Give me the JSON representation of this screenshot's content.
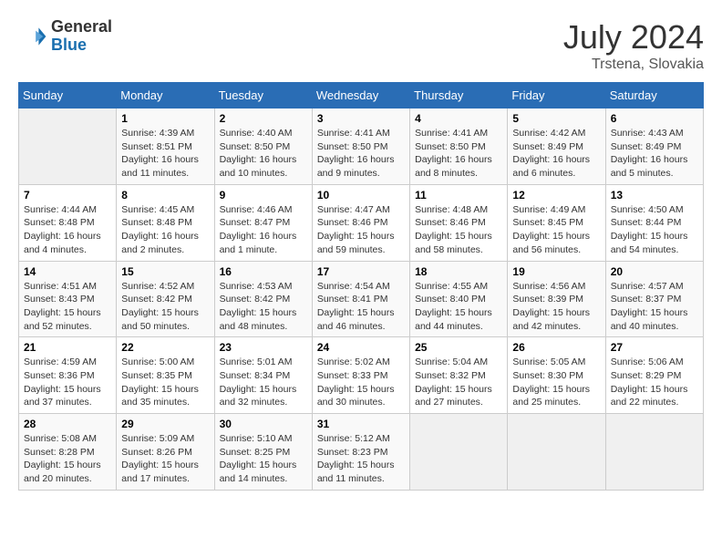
{
  "header": {
    "logo": {
      "general": "General",
      "blue": "Blue"
    },
    "title": "July 2024",
    "location": "Trstena, Slovakia"
  },
  "weekdays": [
    "Sunday",
    "Monday",
    "Tuesday",
    "Wednesday",
    "Thursday",
    "Friday",
    "Saturday"
  ],
  "weeks": [
    [
      {
        "day": null
      },
      {
        "day": "1",
        "sunrise": "4:39 AM",
        "sunset": "8:51 PM",
        "daylight": "16 hours and 11 minutes."
      },
      {
        "day": "2",
        "sunrise": "4:40 AM",
        "sunset": "8:50 PM",
        "daylight": "16 hours and 10 minutes."
      },
      {
        "day": "3",
        "sunrise": "4:41 AM",
        "sunset": "8:50 PM",
        "daylight": "16 hours and 9 minutes."
      },
      {
        "day": "4",
        "sunrise": "4:41 AM",
        "sunset": "8:50 PM",
        "daylight": "16 hours and 8 minutes."
      },
      {
        "day": "5",
        "sunrise": "4:42 AM",
        "sunset": "8:49 PM",
        "daylight": "16 hours and 6 minutes."
      },
      {
        "day": "6",
        "sunrise": "4:43 AM",
        "sunset": "8:49 PM",
        "daylight": "16 hours and 5 minutes."
      }
    ],
    [
      {
        "day": "7",
        "sunrise": "4:44 AM",
        "sunset": "8:48 PM",
        "daylight": "16 hours and 4 minutes."
      },
      {
        "day": "8",
        "sunrise": "4:45 AM",
        "sunset": "8:48 PM",
        "daylight": "16 hours and 2 minutes."
      },
      {
        "day": "9",
        "sunrise": "4:46 AM",
        "sunset": "8:47 PM",
        "daylight": "16 hours and 1 minute."
      },
      {
        "day": "10",
        "sunrise": "4:47 AM",
        "sunset": "8:46 PM",
        "daylight": "15 hours and 59 minutes."
      },
      {
        "day": "11",
        "sunrise": "4:48 AM",
        "sunset": "8:46 PM",
        "daylight": "15 hours and 58 minutes."
      },
      {
        "day": "12",
        "sunrise": "4:49 AM",
        "sunset": "8:45 PM",
        "daylight": "15 hours and 56 minutes."
      },
      {
        "day": "13",
        "sunrise": "4:50 AM",
        "sunset": "8:44 PM",
        "daylight": "15 hours and 54 minutes."
      }
    ],
    [
      {
        "day": "14",
        "sunrise": "4:51 AM",
        "sunset": "8:43 PM",
        "daylight": "15 hours and 52 minutes."
      },
      {
        "day": "15",
        "sunrise": "4:52 AM",
        "sunset": "8:42 PM",
        "daylight": "15 hours and 50 minutes."
      },
      {
        "day": "16",
        "sunrise": "4:53 AM",
        "sunset": "8:42 PM",
        "daylight": "15 hours and 48 minutes."
      },
      {
        "day": "17",
        "sunrise": "4:54 AM",
        "sunset": "8:41 PM",
        "daylight": "15 hours and 46 minutes."
      },
      {
        "day": "18",
        "sunrise": "4:55 AM",
        "sunset": "8:40 PM",
        "daylight": "15 hours and 44 minutes."
      },
      {
        "day": "19",
        "sunrise": "4:56 AM",
        "sunset": "8:39 PM",
        "daylight": "15 hours and 42 minutes."
      },
      {
        "day": "20",
        "sunrise": "4:57 AM",
        "sunset": "8:37 PM",
        "daylight": "15 hours and 40 minutes."
      }
    ],
    [
      {
        "day": "21",
        "sunrise": "4:59 AM",
        "sunset": "8:36 PM",
        "daylight": "15 hours and 37 minutes."
      },
      {
        "day": "22",
        "sunrise": "5:00 AM",
        "sunset": "8:35 PM",
        "daylight": "15 hours and 35 minutes."
      },
      {
        "day": "23",
        "sunrise": "5:01 AM",
        "sunset": "8:34 PM",
        "daylight": "15 hours and 32 minutes."
      },
      {
        "day": "24",
        "sunrise": "5:02 AM",
        "sunset": "8:33 PM",
        "daylight": "15 hours and 30 minutes."
      },
      {
        "day": "25",
        "sunrise": "5:04 AM",
        "sunset": "8:32 PM",
        "daylight": "15 hours and 27 minutes."
      },
      {
        "day": "26",
        "sunrise": "5:05 AM",
        "sunset": "8:30 PM",
        "daylight": "15 hours and 25 minutes."
      },
      {
        "day": "27",
        "sunrise": "5:06 AM",
        "sunset": "8:29 PM",
        "daylight": "15 hours and 22 minutes."
      }
    ],
    [
      {
        "day": "28",
        "sunrise": "5:08 AM",
        "sunset": "8:28 PM",
        "daylight": "15 hours and 20 minutes."
      },
      {
        "day": "29",
        "sunrise": "5:09 AM",
        "sunset": "8:26 PM",
        "daylight": "15 hours and 17 minutes."
      },
      {
        "day": "30",
        "sunrise": "5:10 AM",
        "sunset": "8:25 PM",
        "daylight": "15 hours and 14 minutes."
      },
      {
        "day": "31",
        "sunrise": "5:12 AM",
        "sunset": "8:23 PM",
        "daylight": "15 hours and 11 minutes."
      },
      {
        "day": null
      },
      {
        "day": null
      },
      {
        "day": null
      }
    ]
  ],
  "labels": {
    "sunrise": "Sunrise:",
    "sunset": "Sunset:",
    "daylight": "Daylight hours"
  }
}
